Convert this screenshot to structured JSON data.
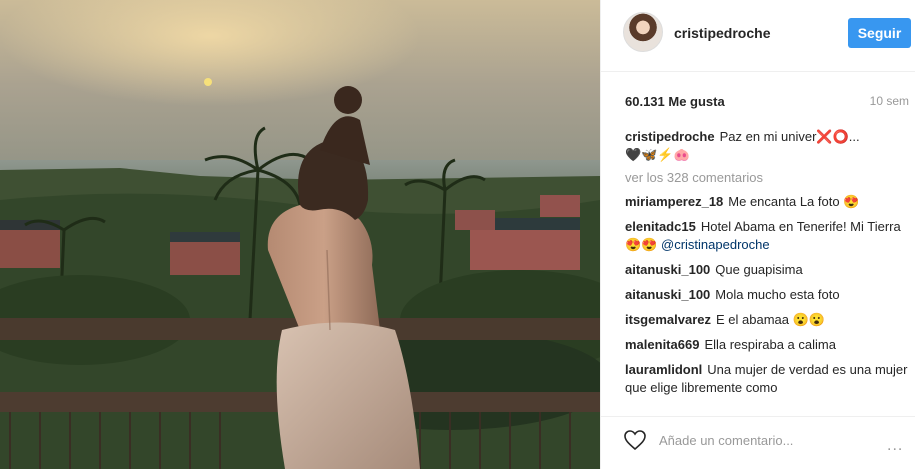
{
  "post": {
    "username": "cristipedroche",
    "follow_label": "Seguir",
    "likes": "60.131 Me gusta",
    "time": "10 sem",
    "caption_user": "cristipedroche",
    "caption_text": "Paz en mi univer",
    "caption_emojis_1": "❌⭕...",
    "caption_emojis_2": "🖤🦋⚡🐽",
    "view_comments": "ver los 328 comentarios",
    "add_comment_placeholder": "Añade un comentario...",
    "more_options": "..."
  },
  "comments": [
    {
      "user": "miriamperez_18",
      "text": "Me encanta La foto 😍"
    },
    {
      "user": "elenitadc15",
      "text": "Hotel Abama en Tenerife! Mi Tierra😍😍",
      "mention": "@cristinapedroche"
    },
    {
      "user": "aitanuski_100",
      "text": "Que guapisima"
    },
    {
      "user": "aitanuski_100",
      "text": "Mola mucho esta foto"
    },
    {
      "user": "itsgemalvarez",
      "text": "E el abamaa 😮😮"
    },
    {
      "user": "malenita669",
      "text": "Ella respiraba a calima"
    },
    {
      "user": "lauramlidonl",
      "text": "Una mujer de verdad es una mujer que elige libremente como"
    }
  ],
  "colors": {
    "accent": "#3897f0",
    "username": "#262626",
    "muted": "#999999",
    "mention": "#003569"
  },
  "icons": {
    "like": "heart-outline-icon",
    "options": "more-dots-icon"
  }
}
